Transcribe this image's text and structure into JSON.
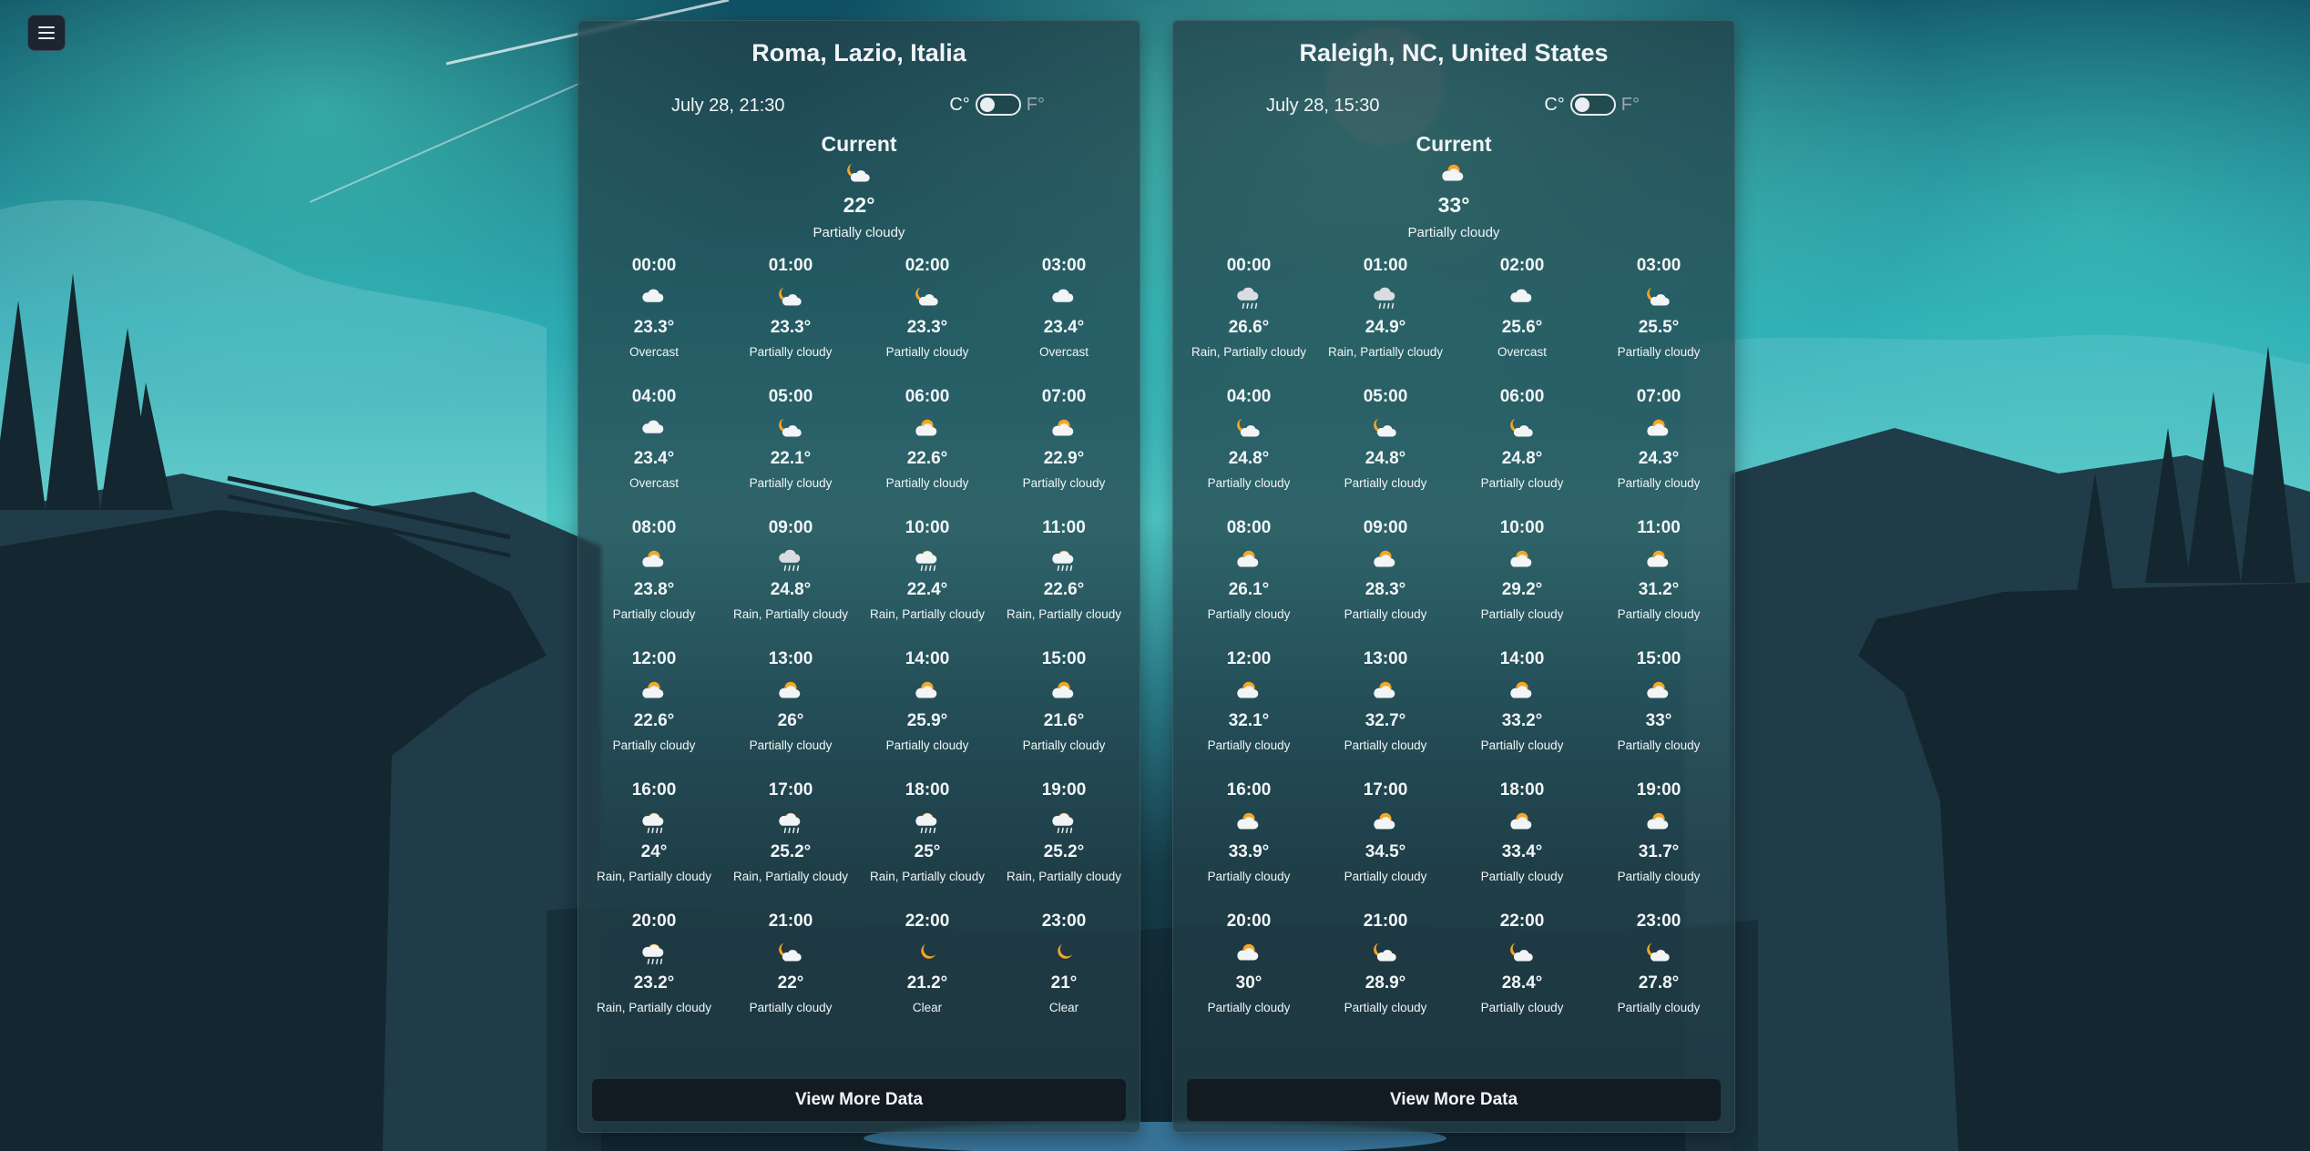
{
  "menu": {
    "icon": "hamburger-icon"
  },
  "unit_labels": {
    "celsius": "C°",
    "fahrenheit": "F°"
  },
  "cards": [
    {
      "location": "Roma, Lazio, Italia",
      "datetime": "July 28, 21:30",
      "current": {
        "label": "Current",
        "icon": "night-partly-cloudy",
        "temp": "22°",
        "condition": "Partially cloudy"
      },
      "hours": [
        {
          "time": "00:00",
          "icon": "cloud",
          "temp": "23.3°",
          "condition": "Overcast"
        },
        {
          "time": "01:00",
          "icon": "night-partly-cloudy",
          "temp": "23.3°",
          "condition": "Partially cloudy"
        },
        {
          "time": "02:00",
          "icon": "night-partly-cloudy",
          "temp": "23.3°",
          "condition": "Partially cloudy"
        },
        {
          "time": "03:00",
          "icon": "cloud",
          "temp": "23.4°",
          "condition": "Overcast"
        },
        {
          "time": "04:00",
          "icon": "cloud",
          "temp": "23.4°",
          "condition": "Overcast"
        },
        {
          "time": "05:00",
          "icon": "night-partly-cloudy",
          "temp": "22.1°",
          "condition": "Partially cloudy"
        },
        {
          "time": "06:00",
          "icon": "day-partly-cloudy",
          "temp": "22.6°",
          "condition": "Partially cloudy"
        },
        {
          "time": "07:00",
          "icon": "day-partly-cloudy",
          "temp": "22.9°",
          "condition": "Partially cloudy"
        },
        {
          "time": "08:00",
          "icon": "day-partly-cloudy",
          "temp": "23.8°",
          "condition": "Partially cloudy"
        },
        {
          "time": "09:00",
          "icon": "rain-cloud",
          "temp": "24.8°",
          "condition": "Rain, Partially cloudy"
        },
        {
          "time": "10:00",
          "icon": "day-rain",
          "temp": "22.4°",
          "condition": "Rain, Partially cloudy"
        },
        {
          "time": "11:00",
          "icon": "day-rain",
          "temp": "22.6°",
          "condition": "Rain, Partially cloudy"
        },
        {
          "time": "12:00",
          "icon": "day-partly-cloudy",
          "temp": "22.6°",
          "condition": "Partially cloudy"
        },
        {
          "time": "13:00",
          "icon": "day-partly-cloudy",
          "temp": "26°",
          "condition": "Partially cloudy"
        },
        {
          "time": "14:00",
          "icon": "day-partly-cloudy",
          "temp": "25.9°",
          "condition": "Partially cloudy"
        },
        {
          "time": "15:00",
          "icon": "day-partly-cloudy",
          "temp": "21.6°",
          "condition": "Partially cloudy"
        },
        {
          "time": "16:00",
          "icon": "day-rain",
          "temp": "24°",
          "condition": "Rain, Partially cloudy"
        },
        {
          "time": "17:00",
          "icon": "day-rain",
          "temp": "25.2°",
          "condition": "Rain, Partially cloudy"
        },
        {
          "time": "18:00",
          "icon": "day-rain",
          "temp": "25°",
          "condition": "Rain, Partially cloudy"
        },
        {
          "time": "19:00",
          "icon": "day-rain",
          "temp": "25.2°",
          "condition": "Rain, Partially cloudy"
        },
        {
          "time": "20:00",
          "icon": "day-rain",
          "temp": "23.2°",
          "condition": "Rain, Partially cloudy"
        },
        {
          "time": "21:00",
          "icon": "night-partly-cloudy",
          "temp": "22°",
          "condition": "Partially cloudy"
        },
        {
          "time": "22:00",
          "icon": "moon",
          "temp": "21.2°",
          "condition": "Clear"
        },
        {
          "time": "23:00",
          "icon": "moon",
          "temp": "21°",
          "condition": "Clear"
        }
      ],
      "button": "View More Data"
    },
    {
      "location": "Raleigh, NC, United States",
      "datetime": "July 28, 15:30",
      "current": {
        "label": "Current",
        "icon": "day-partly-cloudy",
        "temp": "33°",
        "condition": "Partially cloudy"
      },
      "hours": [
        {
          "time": "00:00",
          "icon": "rain-cloud",
          "temp": "26.6°",
          "condition": "Rain, Partially cloudy"
        },
        {
          "time": "01:00",
          "icon": "rain-cloud",
          "temp": "24.9°",
          "condition": "Rain, Partially cloudy"
        },
        {
          "time": "02:00",
          "icon": "cloud",
          "temp": "25.6°",
          "condition": "Overcast"
        },
        {
          "time": "03:00",
          "icon": "night-partly-cloudy",
          "temp": "25.5°",
          "condition": "Partially cloudy"
        },
        {
          "time": "04:00",
          "icon": "night-partly-cloudy",
          "temp": "24.8°",
          "condition": "Partially cloudy"
        },
        {
          "time": "05:00",
          "icon": "night-partly-cloudy",
          "temp": "24.8°",
          "condition": "Partially cloudy"
        },
        {
          "time": "06:00",
          "icon": "night-partly-cloudy",
          "temp": "24.8°",
          "condition": "Partially cloudy"
        },
        {
          "time": "07:00",
          "icon": "day-partly-cloudy",
          "temp": "24.3°",
          "condition": "Partially cloudy"
        },
        {
          "time": "08:00",
          "icon": "day-partly-cloudy",
          "temp": "26.1°",
          "condition": "Partially cloudy"
        },
        {
          "time": "09:00",
          "icon": "day-partly-cloudy",
          "temp": "28.3°",
          "condition": "Partially cloudy"
        },
        {
          "time": "10:00",
          "icon": "day-partly-cloudy",
          "temp": "29.2°",
          "condition": "Partially cloudy"
        },
        {
          "time": "11:00",
          "icon": "day-partly-cloudy",
          "temp": "31.2°",
          "condition": "Partially cloudy"
        },
        {
          "time": "12:00",
          "icon": "day-partly-cloudy",
          "temp": "32.1°",
          "condition": "Partially cloudy"
        },
        {
          "time": "13:00",
          "icon": "day-partly-cloudy",
          "temp": "32.7°",
          "condition": "Partially cloudy"
        },
        {
          "time": "14:00",
          "icon": "day-partly-cloudy",
          "temp": "33.2°",
          "condition": "Partially cloudy"
        },
        {
          "time": "15:00",
          "icon": "day-partly-cloudy",
          "temp": "33°",
          "condition": "Partially cloudy"
        },
        {
          "time": "16:00",
          "icon": "day-partly-cloudy",
          "temp": "33.9°",
          "condition": "Partially cloudy"
        },
        {
          "time": "17:00",
          "icon": "day-partly-cloudy",
          "temp": "34.5°",
          "condition": "Partially cloudy"
        },
        {
          "time": "18:00",
          "icon": "day-partly-cloudy",
          "temp": "33.4°",
          "condition": "Partially cloudy"
        },
        {
          "time": "19:00",
          "icon": "day-partly-cloudy",
          "temp": "31.7°",
          "condition": "Partially cloudy"
        },
        {
          "time": "20:00",
          "icon": "day-partly-cloudy",
          "temp": "30°",
          "condition": "Partially cloudy"
        },
        {
          "time": "21:00",
          "icon": "night-partly-cloudy",
          "temp": "28.9°",
          "condition": "Partially cloudy"
        },
        {
          "time": "22:00",
          "icon": "night-partly-cloudy",
          "temp": "28.4°",
          "condition": "Partially cloudy"
        },
        {
          "time": "23:00",
          "icon": "night-partly-cloudy",
          "temp": "27.8°",
          "condition": "Partially cloudy"
        }
      ],
      "button": "View More Data"
    }
  ]
}
